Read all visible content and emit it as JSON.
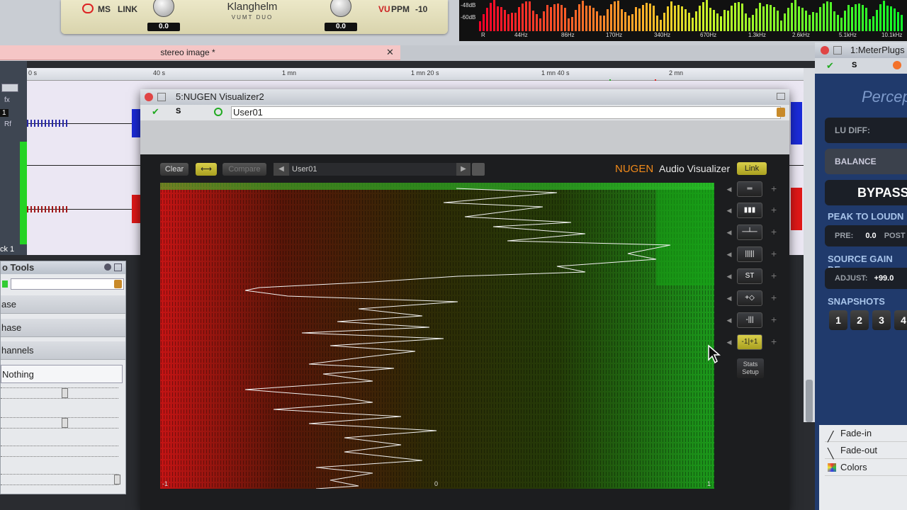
{
  "klanghelm": {
    "labels": [
      "MS",
      "LINK",
      "VU",
      "PPM",
      "-10"
    ],
    "title": "Klanghelm",
    "subtitle": "VUMT DUO",
    "left_value": "0.0",
    "right_value": "0.0"
  },
  "spectrum": {
    "db_labels": [
      "-48dB",
      "-60dB"
    ],
    "freq_labels": [
      "R",
      "44Hz",
      "86Hz",
      "170Hz",
      "340Hz",
      "670Hz",
      "1.3kHz",
      "2.6kHz",
      "5.1kHz",
      "10.1kHz"
    ]
  },
  "editor": {
    "tab_title": "stereo image *",
    "close_glyph": "✕",
    "ruler_ticks": [
      "0 s",
      "40 s",
      "1 mn",
      "1 mn 20 s",
      "1 mn 40 s",
      "2 mn"
    ],
    "track_label": "ck 1",
    "track_side": [
      "fx",
      "1",
      "Rf"
    ]
  },
  "tools_panel": {
    "title": "o Tools",
    "items": [
      "ase",
      "hase",
      "hannels",
      "Nothing"
    ]
  },
  "nugen_window": {
    "title": "5:NUGEN Visualizer2",
    "preset": "User01",
    "buttons": {
      "clear": "Clear",
      "compare": "Compare",
      "link": "Link"
    },
    "preset_name": "User01",
    "brand": "NUGEN",
    "brand_suffix": "Audio Visualizer",
    "axis_labels": [
      "-1",
      "0",
      "1"
    ],
    "stats_setup": [
      "Stats",
      "Setup"
    ],
    "side_buttons": [
      "bars",
      "spectrum",
      "peaks",
      "lines",
      "ST",
      "add",
      "balance",
      "-1 | +1"
    ]
  },
  "meterplugs": {
    "title": "1:MeterPlugs",
    "brand_word": "Percept",
    "lu_diff": "LU DIFF:",
    "balance": "BALANCE",
    "bypass": "BYPASS",
    "peak_to_loudness": "PEAK TO LOUDN",
    "pre_label": "PRE:",
    "pre_value": "0.0",
    "post_label": "POST",
    "source_gain": "SOURCE GAIN DE",
    "adjust_label": "ADJUST:",
    "adjust_value": "+99.0",
    "snapshots": "SNAPSHOTS",
    "snapshot_nums": [
      "1",
      "2",
      "3",
      "4"
    ],
    "menu": [
      "Fade-in",
      "Fade-out",
      "Colors"
    ]
  },
  "colors": {
    "accent_red": "#e03a3a",
    "accent_green": "#1fa21f",
    "meter_blue": "#203a6c",
    "nugen_gold": "#d4c120"
  }
}
